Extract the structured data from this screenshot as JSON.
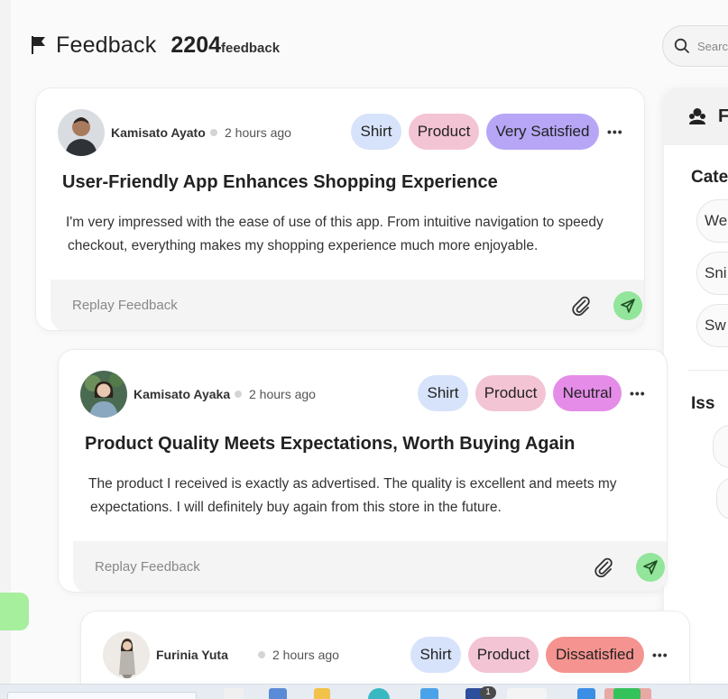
{
  "header": {
    "title": "Feedback",
    "count": "2204",
    "unit": "feedback"
  },
  "search": {
    "placeholder": "Search"
  },
  "right_panel": {
    "heading": "F",
    "category_label": "Cate",
    "category_chips": [
      "Wea",
      "Sni",
      "Sw"
    ],
    "issue_label": "Iss"
  },
  "cards": [
    {
      "author": "Kamisato Ayato",
      "time": "2 hours ago",
      "tags": [
        "Shirt",
        "Product",
        "Very Satisfied"
      ],
      "more": "•••",
      "title": "User-Friendly App Enhances Shopping Experience",
      "body_lines": [
        "I'm very impressed with the ease of use of this app. From intuitive navigation to speedy",
        "checkout, everything makes my shopping experience much more enjoyable."
      ],
      "reply_placeholder": "Replay Feedback"
    },
    {
      "author": "Kamisato Ayaka",
      "time": "2 hours ago",
      "tags": [
        "Shirt",
        "Product",
        "Neutral"
      ],
      "more": "•••",
      "title": "Product Quality Meets Expectations, Worth Buying Again",
      "body_lines": [
        "The product I received is exactly as advertised. The quality is excellent and meets my",
        "expectations. I will definitely buy again from this store in the future."
      ],
      "reply_placeholder": "Replay Feedback"
    },
    {
      "author": "Furinia Yuta",
      "time": "2 hours ago",
      "tags": [
        "Shirt",
        "Product",
        "Dissatisfied"
      ],
      "more": "•••"
    }
  ],
  "taskbar": {
    "badge": "1"
  },
  "colors": {
    "very_satisfied": "#b7a6f6",
    "neutral": "#e58ce8",
    "dissatisfied": "#f4938f",
    "send": "#92e59a",
    "accent_green": "#a5ef9d"
  },
  "icons": [
    "flag-icon",
    "search-icon",
    "users-icon",
    "paperclip-icon",
    "send-icon",
    "more-icon"
  ]
}
